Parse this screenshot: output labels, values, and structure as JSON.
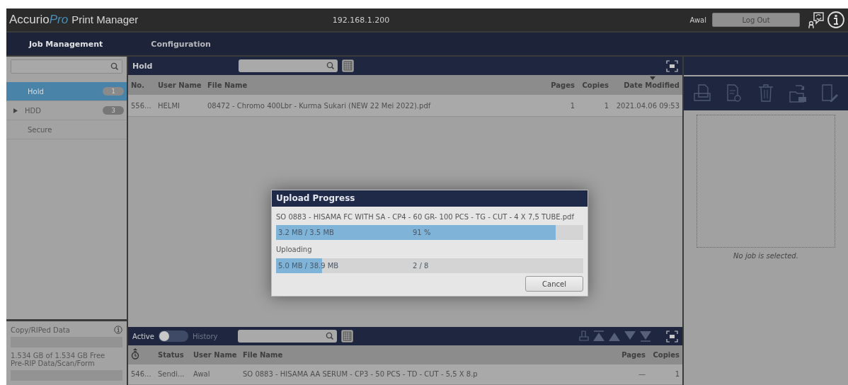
{
  "header": {
    "logo": "Accurio",
    "logo_accent": "Pro",
    "product": "Print Manager",
    "address": "192.168.1.200",
    "user": "Awal",
    "logout": "Log Out"
  },
  "nav": [
    {
      "label": "Job Management",
      "selected": true
    },
    {
      "label": "Configuration",
      "selected": false
    }
  ],
  "sidebar": {
    "items": [
      {
        "label": "Hold",
        "badge": "1",
        "selected": true,
        "expandable": false
      },
      {
        "label": "HDD",
        "badge": "3",
        "selected": false,
        "expandable": true
      },
      {
        "label": "Secure",
        "selected": false,
        "expandable": false
      }
    ],
    "storage": [
      {
        "label": "Copy/RIPed Data",
        "info": true,
        "note": "1.534 GB of 1.534 GB Free"
      },
      {
        "label": "Pre-RIP Data/Scan/Form",
        "info": false
      }
    ]
  },
  "hold_list": {
    "title": "Hold",
    "columns": [
      {
        "label": "No.",
        "sorted": false
      },
      {
        "label": "User Name",
        "sorted": false
      },
      {
        "label": "File Name",
        "sorted": false
      },
      {
        "label": "Pages",
        "sorted": false
      },
      {
        "label": "Copies",
        "sorted": false
      },
      {
        "label": "Date Modified",
        "sorted": true
      }
    ],
    "rows": [
      [
        "556...",
        "HELMI",
        "08472 - Chromo 400Lbr - Kurma Sukari (NEW 22 Mei 2022).pdf",
        "1",
        "1",
        "2021.04.06 09:53"
      ]
    ]
  },
  "job_list": {
    "modes": [
      {
        "label": "Active",
        "selected": true
      },
      {
        "label": "History",
        "selected": false
      }
    ],
    "columns": [
      {
        "kind": "timer"
      },
      {
        "label": "Status",
        "kind": "text"
      },
      {
        "label": "User Name",
        "kind": "text"
      },
      {
        "label": "File Name",
        "kind": "text"
      },
      {
        "label": "Pages",
        "kind": "text"
      },
      {
        "label": "Copies",
        "kind": "text"
      }
    ],
    "rows": [
      [
        "546...",
        "Sendi...",
        "Awal",
        "SO 0883 - HISAMA AA SERUM - CP3 - 50 PCS - TD - CUT - 5,5 X 8.p",
        "—",
        "1"
      ]
    ]
  },
  "detail": {
    "empty_text": "No job is selected."
  },
  "dialog": {
    "title": "Upload Progress",
    "file": "SO 0883 - HISAMA FC WITH SA - CP4 - 60 GR- 100 PCS - TG - CUT - 4 X 7,5 TUBE.pdf",
    "bars": [
      {
        "size": "3.2 MB / 3.5 MB",
        "reading": "91 %",
        "level": 0.91
      },
      {
        "caption": "Uploading",
        "size": "5.0 MB / 38.9 MB",
        "reading": "2 / 8",
        "level": 0.15
      }
    ],
    "button": "Cancel"
  }
}
